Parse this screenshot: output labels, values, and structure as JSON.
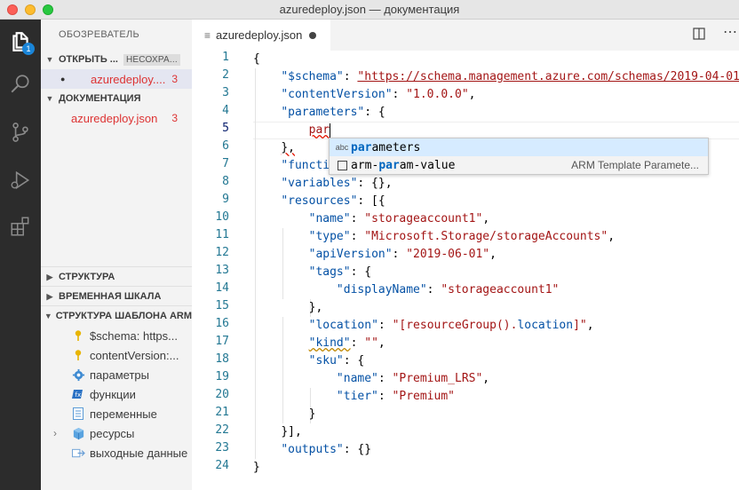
{
  "window": {
    "title": "azuredeploy.json — документация"
  },
  "activity_bar": {
    "explorer_badge": "1"
  },
  "sidebar": {
    "title": "ОБОЗРЕВАТЕЛЬ",
    "open_editors": {
      "label": "ОТКРЫТЬ ...",
      "unsaved_label": "НЕСОХРА...",
      "file": "azuredeploy....",
      "count": "3"
    },
    "folder": {
      "label": "ДОКУМЕНТАЦИЯ",
      "file": "azuredeploy.json",
      "count": "3"
    },
    "outline": "СТРУКТУРА",
    "timeline": "ВРЕМЕННАЯ ШКАЛА",
    "arm_outline": "СТРУКТУРА ШАБЛОНА ARM",
    "arm_items": [
      {
        "label": "$schema: https..."
      },
      {
        "label": "contentVersion:..."
      },
      {
        "label": "параметры"
      },
      {
        "label": "функции"
      },
      {
        "label": "переменные"
      },
      {
        "label": "ресурсы"
      },
      {
        "label": "выходные данные"
      }
    ]
  },
  "editor": {
    "tab_label": "azuredeploy.json",
    "line_numbers": [
      "1",
      "2",
      "3",
      "4",
      "5",
      "6",
      "7",
      "8",
      "9",
      "10",
      "11",
      "12",
      "13",
      "14",
      "15",
      "16",
      "17",
      "18",
      "19",
      "20",
      "21",
      "22",
      "23",
      "24"
    ],
    "code": {
      "l1": "{",
      "l2_key": "\"$schema\"",
      "l2_val": "\"https://schema.management.azure.com/schemas/2019-04-01",
      "l3_key": "\"contentVersion\"",
      "l3_val": "\"1.0.0.0\"",
      "l4_key": "\"parameters\"",
      "l5_typed": "par",
      "l6": "},",
      "l7_key": "\"functi",
      "l8_key": "\"variables\"",
      "l9_key": "\"resources\"",
      "l10_key": "\"name\"",
      "l10_val": "\"storageaccount1\"",
      "l11_key": "\"type\"",
      "l11_val": "\"Microsoft.Storage/storageAccounts\"",
      "l12_key": "\"apiVersion\"",
      "l12_val": "\"2019-06-01\"",
      "l13_key": "\"tags\"",
      "l14_key": "\"displayName\"",
      "l14_val": "\"storageaccount1\"",
      "l15": "},",
      "l16_key": "\"location\"",
      "l16_val_a": "\"[resourceGroup().",
      "l16_val_b": "location",
      "l16_val_c": "]\"",
      "l17_key": "\"kind\"",
      "l17_val": "\"\"",
      "l18_key": "\"sku\"",
      "l19_key": "\"name\"",
      "l19_val": "\"Premium_LRS\"",
      "l20_key": "\"tier\"",
      "l20_val": "\"Premium\"",
      "l21": "}",
      "l22": "}],",
      "l23_key": "\"outputs\"",
      "l24": "}"
    },
    "suggest": {
      "items": [
        {
          "icon": "abc",
          "match": "par",
          "rest": "ameters",
          "detail": ""
        },
        {
          "prefix": "arm-",
          "match": "par",
          "rest": "am-value",
          "detail": "ARM Template Paramete..."
        }
      ]
    }
  }
}
